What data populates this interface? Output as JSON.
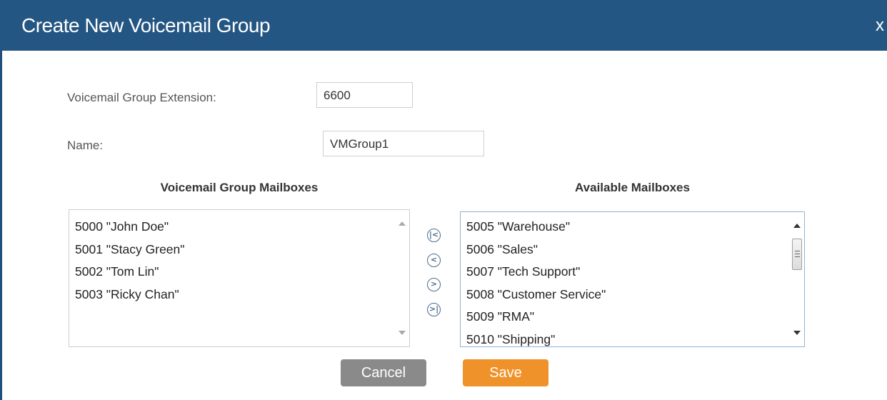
{
  "dialog": {
    "title": "Create New Voicemail Group",
    "close_label": "x"
  },
  "form": {
    "extension_label": "Voicemail Group Extension:",
    "extension_value": "6600",
    "name_label": "Name:",
    "name_value": "VMGroup1"
  },
  "group_mailboxes": {
    "heading": "Voicemail Group Mailboxes",
    "items": [
      "5000 \"John Doe\"",
      "5001 \"Stacy Green\"",
      "5002 \"Tom Lin\"",
      "5003 \"Ricky Chan\""
    ]
  },
  "available_mailboxes": {
    "heading": "Available Mailboxes",
    "items": [
      "5005 \"Warehouse\"",
      "5006 \"Sales\"",
      "5007 \"Tech Support\"",
      "5008 \"Customer Service\"",
      "5009 \"RMA\"",
      "5010 \"Shipping\""
    ]
  },
  "move_buttons": {
    "icons": [
      "move-all-left-icon",
      "move-left-icon",
      "move-right-icon",
      "move-all-right-icon"
    ]
  },
  "buttons": {
    "cancel_label": "Cancel",
    "save_label": "Save"
  },
  "colors": {
    "titlebar": "#245683",
    "save": "#f0922a",
    "cancel": "#8a8a8a"
  }
}
